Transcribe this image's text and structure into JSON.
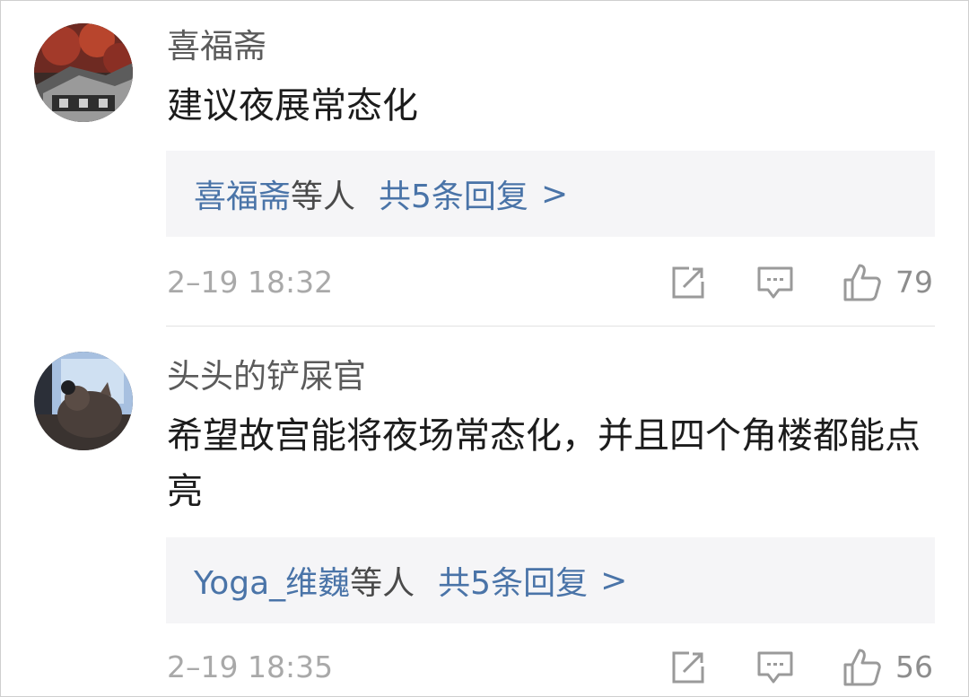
{
  "comments": [
    {
      "username": "喜福斋",
      "content": "建议夜展常态化",
      "replies": {
        "names": "喜福斋",
        "suffix": "等人",
        "count_label": "共5条回复",
        "arrow": ">"
      },
      "timestamp": "2–19 18:32",
      "likes": "79"
    },
    {
      "username": "头头的铲屎官",
      "content": "希望故宫能将夜场常态化，并且四个角楼都能点亮",
      "replies": {
        "names": "Yoga_维巍",
        "suffix": "等人",
        "count_label": "共5条回复",
        "arrow": ">"
      },
      "timestamp": "2–19 18:35",
      "likes": "56"
    }
  ],
  "icons": {
    "share": "share-icon",
    "reply": "comment-icon",
    "like": "thumbs-up-icon"
  },
  "colors": {
    "link": "#4a74a8",
    "reply_box_bg": "#f5f5f7",
    "meta_gray": "#a9a9a9"
  }
}
